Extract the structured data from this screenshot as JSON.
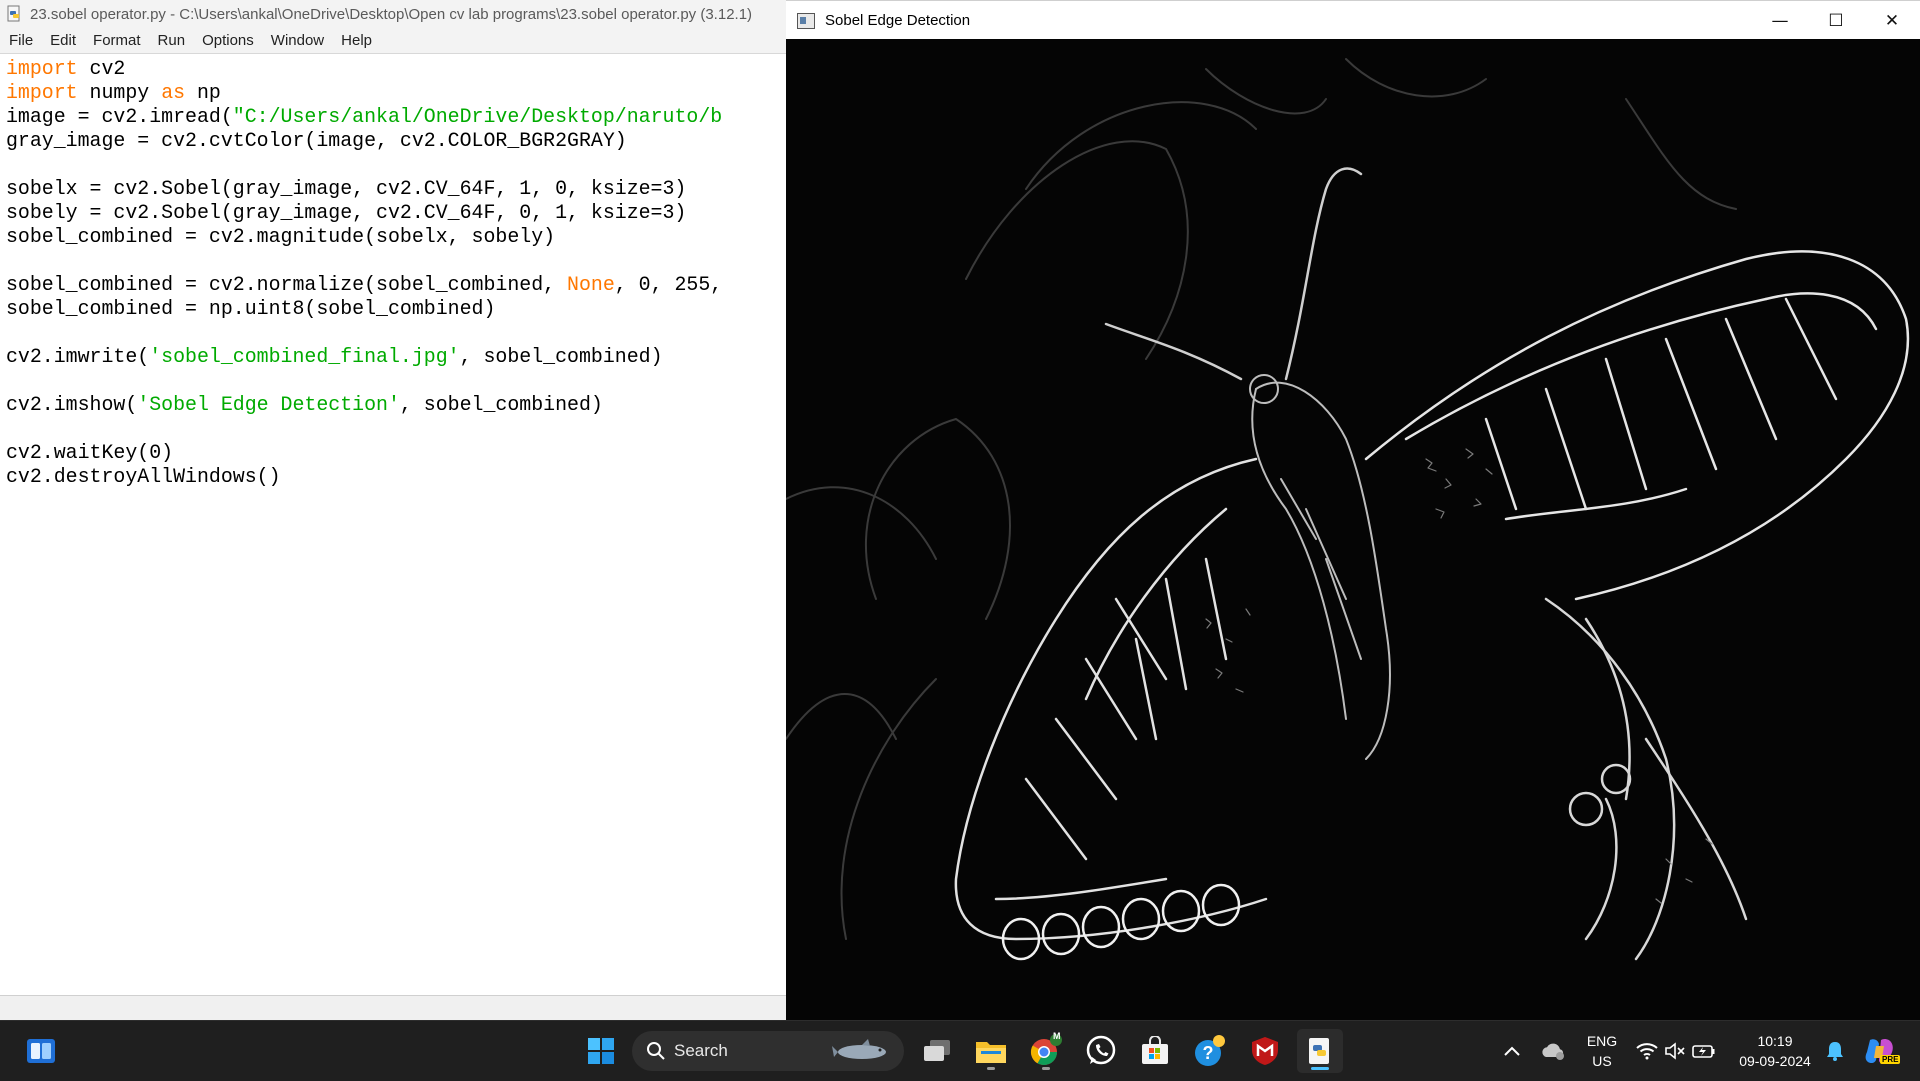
{
  "idle": {
    "title": "23.sobel operator.py - C:\\Users\\ankal\\OneDrive\\Desktop\\Open cv lab programs\\23.sobel operator.py (3.12.1)",
    "menu": [
      "File",
      "Edit",
      "Format",
      "Run",
      "Options",
      "Window",
      "Help"
    ],
    "code": [
      [
        [
          "kw",
          "import"
        ],
        [
          "n",
          " cv2"
        ]
      ],
      [
        [
          "kw",
          "import"
        ],
        [
          "n",
          " numpy "
        ],
        [
          "kw",
          "as"
        ],
        [
          "n",
          " np"
        ]
      ],
      [
        [
          "n",
          "image = cv2.imread("
        ],
        [
          "st",
          "\"C:/Users/ankal/OneDrive/Desktop/naruto/b"
        ]
      ],
      [
        [
          "n",
          "gray_image = cv2.cvtColor(image, cv2.COLOR_BGR2GRAY)"
        ]
      ],
      [
        [
          "n",
          ""
        ]
      ],
      [
        [
          "n",
          "sobelx = cv2.Sobel(gray_image, cv2.CV_64F, 1, 0, ksize=3)"
        ]
      ],
      [
        [
          "n",
          "sobely = cv2.Sobel(gray_image, cv2.CV_64F, 0, 1, ksize=3)"
        ]
      ],
      [
        [
          "n",
          "sobel_combined = cv2.magnitude(sobelx, sobely)"
        ]
      ],
      [
        [
          "n",
          ""
        ]
      ],
      [
        [
          "n",
          "sobel_combined = cv2.normalize(sobel_combined, "
        ],
        [
          "kw",
          "None"
        ],
        [
          "n",
          ", 0, 255,"
        ]
      ],
      [
        [
          "n",
          "sobel_combined = np.uint8(sobel_combined)"
        ]
      ],
      [
        [
          "n",
          ""
        ]
      ],
      [
        [
          "n",
          "cv2.imwrite("
        ],
        [
          "st",
          "'sobel_combined_final.jpg'"
        ],
        [
          "n",
          ", sobel_combined)"
        ]
      ],
      [
        [
          "n",
          ""
        ]
      ],
      [
        [
          "n",
          "cv2.imshow("
        ],
        [
          "st",
          "'Sobel Edge Detection'"
        ],
        [
          "n",
          ", sobel_combined)"
        ]
      ],
      [
        [
          "n",
          ""
        ]
      ],
      [
        [
          "n",
          "cv2.waitKey(0)"
        ]
      ],
      [
        [
          "n",
          "cv2.destroyAllWindows()"
        ]
      ]
    ]
  },
  "cvwindow": {
    "title": "Sobel Edge Detection",
    "minimize": "—",
    "maximize": "☐",
    "close": "✕"
  },
  "taskbar": {
    "search_label": "Search",
    "lang_top": "ENG",
    "lang_bottom": "US",
    "time": "10:19",
    "date": "09-09-2024",
    "chrome_badge": "M",
    "copilot_badge": "PRE",
    "icons": [
      "widgets-icon",
      "windows-start-icon",
      "search-icon",
      "task-view-icon",
      "file-explorer-icon",
      "chrome-icon",
      "whatsapp-icon",
      "microsoft-store-icon",
      "get-help-icon",
      "mcafee-icon",
      "python-idle-icon",
      "show-hidden-icons-chevron",
      "onedrive-icon",
      "wifi-icon",
      "volume-muted-icon",
      "battery-icon",
      "notification-bell-icon",
      "copilot-icon"
    ]
  },
  "colors": {
    "keyword": "#ff7700",
    "string": "#00aa00",
    "taskbar_bg": "#1f1f1f",
    "active_indicator": "#4cc2ff"
  }
}
